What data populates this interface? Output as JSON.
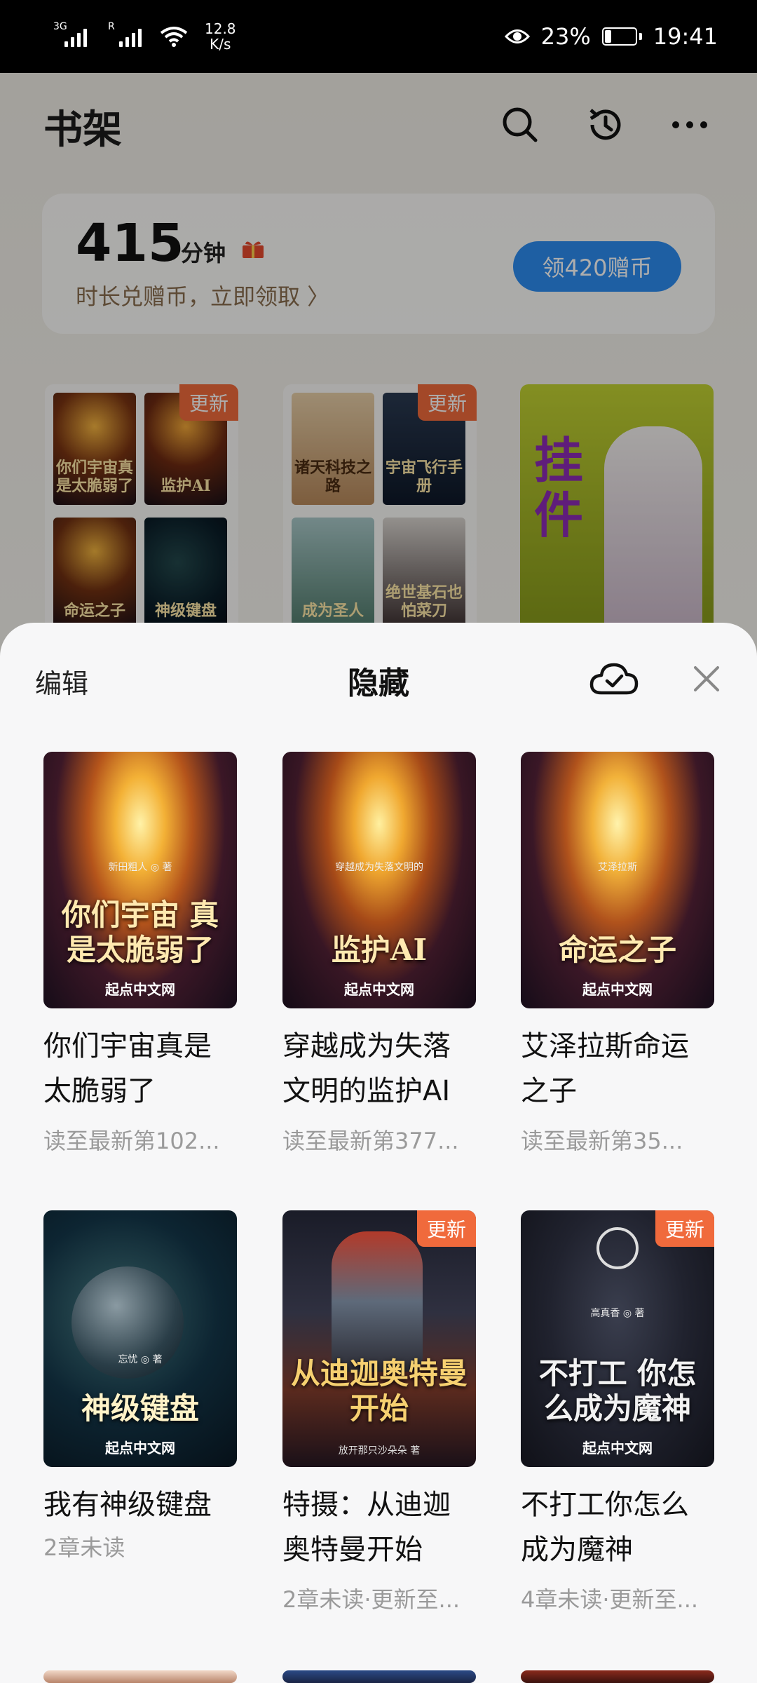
{
  "status_bar": {
    "signal1_tag": "3G",
    "signal2_tag": "R",
    "net_speed": "12.8",
    "net_unit": "K/s",
    "battery": "23%",
    "time": "19:41"
  },
  "shelf": {
    "title": "书架",
    "reward": {
      "minutes": "415",
      "unit": "分钟",
      "subtitle": "时长兑赠币，立即领取 〉",
      "button": "领420赠币"
    },
    "update_tag": "更新",
    "groups": [
      {
        "titles": [
          "你们宇宙真是太脆弱了",
          "监护AI",
          "命运之子",
          "神级键盘"
        ]
      },
      {
        "titles": [
          "诸天科技之路",
          "宇宙飞行手册",
          "成为圣人",
          "绝世基石也怕菜刀"
        ]
      },
      {
        "titles": [
          "挂件"
        ]
      }
    ]
  },
  "sheet": {
    "edit": "编辑",
    "title": "隐藏",
    "books": [
      {
        "name": "你们宇宙真是太脆弱了",
        "status": "读至最新第102...",
        "cover_title": "你们宇宙 真是太脆弱了",
        "cover_author": "新田粗人 ◎ 著",
        "publisher": "起点中文网",
        "updated": false
      },
      {
        "name": "穿越成为失落文明的监护AI",
        "status": "读至最新第377...",
        "cover_title": "监护AI",
        "cover_author": "穿越成为失落文明的",
        "publisher": "起点中文网",
        "updated": false
      },
      {
        "name": "艾泽拉斯命运之子",
        "status": "读至最新第35...",
        "cover_title": "命运之子",
        "cover_author": "艾泽拉斯",
        "publisher": "起点中文网",
        "updated": false
      },
      {
        "name": "我有神级键盘",
        "status": "2章未读",
        "cover_title": "神级键盘",
        "cover_author": "忘忧 ◎ 著",
        "publisher": "起点中文网",
        "updated": false
      },
      {
        "name": "特摄：从迪迦奥特曼开始",
        "status": "2章未读·更新至...",
        "cover_title": "从迪迦奥特曼 开始",
        "cover_author": "放开那只沙朵朵 著",
        "publisher": "起点中文网",
        "updated": true
      },
      {
        "name": "不打工你怎么成为魔神",
        "status": "4章未读·更新至...",
        "cover_title": "不打工 你怎么成为魔神",
        "cover_author": "高真香 ◎ 著",
        "publisher": "起点中文网",
        "updated": true
      }
    ]
  },
  "colors": {
    "update_tag": "#f06a3c",
    "reward_button": "#2d8cf0"
  }
}
